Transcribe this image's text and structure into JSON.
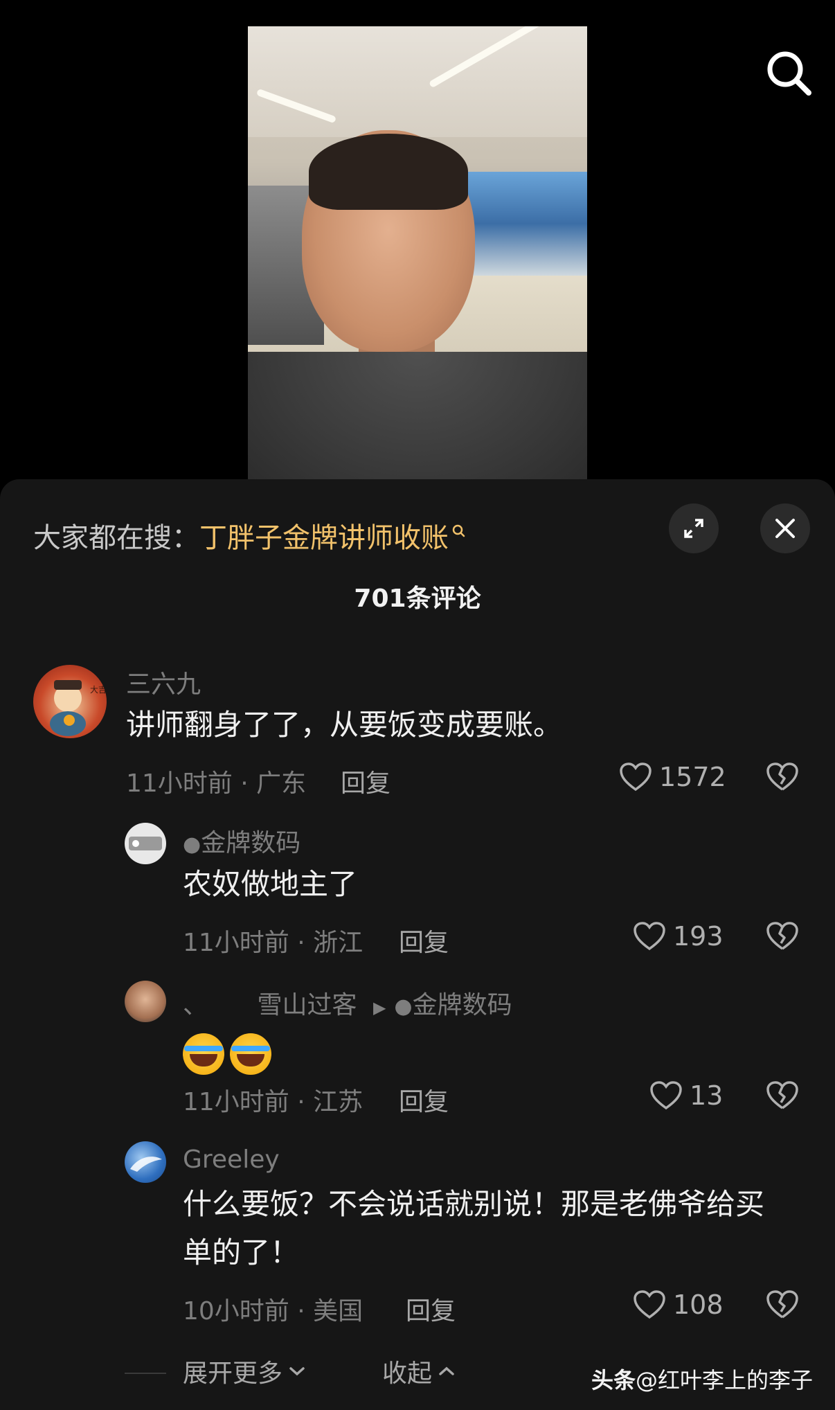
{
  "search_icon": "search-icon",
  "sheet": {
    "trend_prefix": "大家都在搜：",
    "trend_query": "丁胖子金牌讲师收账",
    "comment_count": "701条评论"
  },
  "comments": [
    {
      "author": "三六九",
      "text": "讲师翻身了了，从要饭变成要账。",
      "time_loc": "11小时前 · 广东",
      "reply": "回复",
      "likes": "1572"
    },
    {
      "author": "金牌数码",
      "text": "农奴做地主了",
      "time_loc": "11小时前 · 浙江",
      "reply": "回复",
      "likes": "193"
    },
    {
      "author_prefix": "、",
      "author": "雪山过客",
      "reply_to": "金牌数码",
      "time_loc": "11小时前 · 江苏",
      "reply": "回复",
      "likes": "13"
    },
    {
      "author": "Greeley",
      "text_line1": "什么要饭？不会说话就别说！那是老佛爷给买",
      "text_line2": "单的了！",
      "time_loc": "10小时前 · 美国",
      "reply": "回复",
      "likes": "108"
    }
  ],
  "footer": {
    "expand_more": "展开更多",
    "collapse": "收起",
    "watermark_brand": "头条",
    "watermark_user": "@红叶李上的李子"
  },
  "colors": {
    "accent": "#f2c26b",
    "sheet_bg": "#161616"
  }
}
